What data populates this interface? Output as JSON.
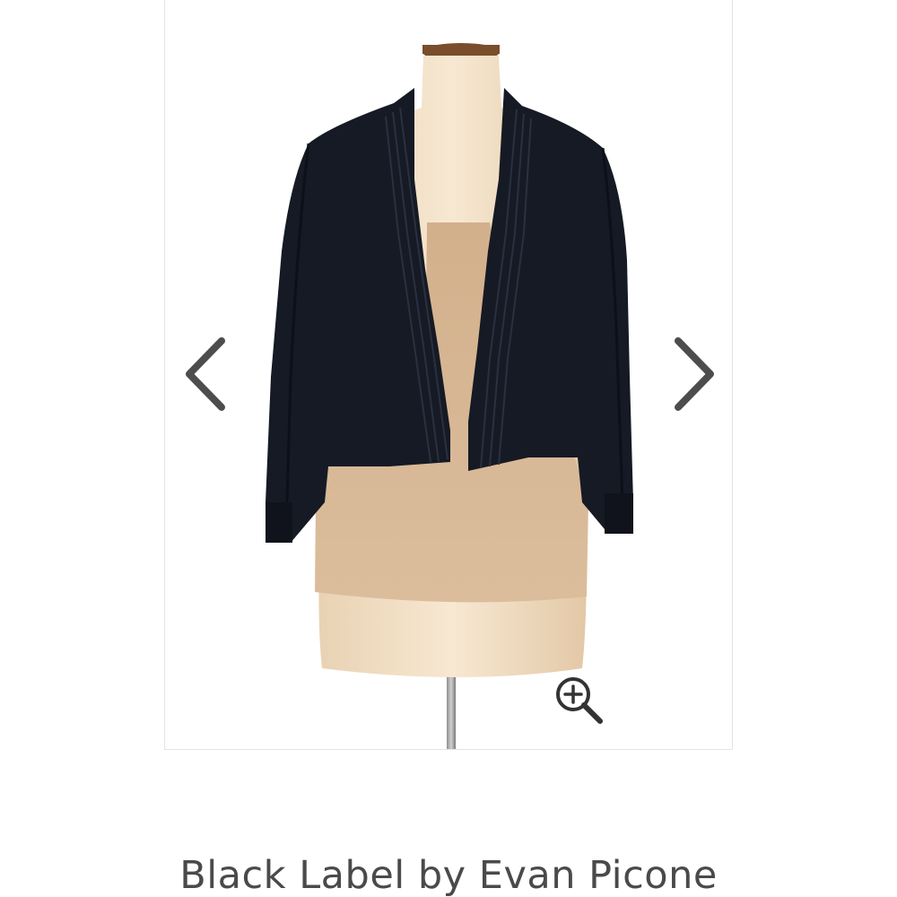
{
  "product": {
    "brand_title": "Black Label by Evan Picone",
    "image_alt": "Black Label by Evan Picone cardigan"
  },
  "gallery": {
    "prev_icon": "chevron-left-icon",
    "next_icon": "chevron-right-icon",
    "zoom_icon": "zoom-in-icon"
  },
  "colors": {
    "title_text": "#4a4a4a",
    "arrow": "#4d4d4d",
    "frame_border": "#e4e4e4",
    "cardigan": "#151a24",
    "top": "#d6b593",
    "mannequin": "#f3e1c6"
  }
}
